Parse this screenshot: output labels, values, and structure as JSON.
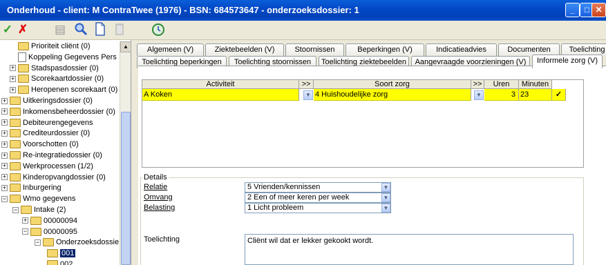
{
  "window": {
    "title": "Onderhoud - client:  M ContraTwee (1976) - BSN: 684573647 - onderzoeksdossier: 1",
    "minimize": "_",
    "maximize": "□",
    "close": "✕"
  },
  "toolbar": {
    "icons": [
      "checkmark-icon",
      "delete-x-icon",
      "stack-icon",
      "magnifier-icon",
      "document-icon",
      "trash-icon",
      "refresh-clock-icon"
    ],
    "check_glyph": "✓",
    "x_glyph": "✗",
    "stack_glyph": "▤",
    "search_glyph": "🔍",
    "doc_glyph": "▯",
    "trash_glyph": "▯",
    "refresh_glyph": "⟳"
  },
  "tree": {
    "items": [
      {
        "label": "Prioriteit cliënt (0)",
        "level": 2,
        "expander": "",
        "icon": "folder"
      },
      {
        "label": "Koppeling Gegevens Pers",
        "level": 2,
        "expander": "",
        "icon": "doc"
      },
      {
        "label": "Stadspasdossier (0)",
        "level": 2,
        "expander": "+",
        "icon": "folder"
      },
      {
        "label": "Scorekaartdossier (0)",
        "level": 2,
        "expander": "+",
        "icon": "folder"
      },
      {
        "label": "Heropenen scorekaart (0)",
        "level": 2,
        "expander": "+",
        "icon": "folder"
      },
      {
        "label": "Uitkeringsdossier (0)",
        "level": 0,
        "expander": "+",
        "icon": "folder"
      },
      {
        "label": "Inkomensbeheerdossier (0)",
        "level": 0,
        "expander": "+",
        "icon": "folder"
      },
      {
        "label": "Debiteurengegevens",
        "level": 0,
        "expander": "+",
        "icon": "folder"
      },
      {
        "label": "Crediteurdossier (0)",
        "level": 0,
        "expander": "+",
        "icon": "folder"
      },
      {
        "label": "Voorschotten (0)",
        "level": 0,
        "expander": "+",
        "icon": "folder"
      },
      {
        "label": "Re-integratiedossier (0)",
        "level": 0,
        "expander": "+",
        "icon": "folder"
      },
      {
        "label": "Werkprocessen (1/2)",
        "level": 0,
        "expander": "+",
        "icon": "folder"
      },
      {
        "label": "Kinderopvangdossier (0)",
        "level": 0,
        "expander": "+",
        "icon": "folder"
      },
      {
        "label": "Inburgering",
        "level": 0,
        "expander": "+",
        "icon": "folder"
      },
      {
        "label": "Wmo gegevens",
        "level": 0,
        "expander": "−",
        "icon": "folder"
      },
      {
        "label": "Intake (2)",
        "level": 1,
        "expander": "−",
        "icon": "folder"
      },
      {
        "label": "00000094",
        "level": 2,
        "expander": "+",
        "icon": "folder"
      },
      {
        "label": "00000095",
        "level": 2,
        "expander": "−",
        "icon": "folder"
      },
      {
        "label": "Onderzoeksdossie",
        "level": 3,
        "expander": "−",
        "icon": "folder"
      },
      {
        "label": "001",
        "level": 4,
        "expander": "",
        "icon": "folder",
        "selected": true
      },
      {
        "label": "002",
        "level": 4,
        "expander": "",
        "icon": "folder"
      }
    ]
  },
  "tabs_top": [
    "Algemeen (V)",
    "Ziektebeelden (V)",
    "Stoornissen",
    "Beperkingen (V)",
    "Indicatieadvies",
    "Documenten",
    "Toelichting"
  ],
  "tabs_bottom": [
    "Toelichting beperkingen",
    "Toelichting stoornissen",
    "Toelichting ziektebeelden",
    "Aangevraagde voorzieningen (V)",
    "Informele zorg (V)"
  ],
  "active_tab": "Informele zorg (V)",
  "grid": {
    "headers": {
      "activiteit": "Activiteit",
      "more1": ">>",
      "soort": "Soort zorg",
      "more2": ">>",
      "uren": "Uren",
      "minuten": "Minuten"
    },
    "row": {
      "activiteit": "A Koken",
      "soort": "4 Huishoudelijke zorg",
      "uren": "3",
      "minuten": "23",
      "check": "✓"
    }
  },
  "details": {
    "legend": "Details",
    "relatie_label": "Relatie",
    "relatie_value": "5 Vrienden/kennissen",
    "omvang_label": "Omvang",
    "omvang_value": "2 Een of meer keren per week",
    "belasting_label": "Belasting",
    "belasting_value": "1 Licht probleem",
    "toelichting_label": "Toelichting",
    "toelichting_value": "Cliënt wil dat er lekker gekookt wordt."
  }
}
